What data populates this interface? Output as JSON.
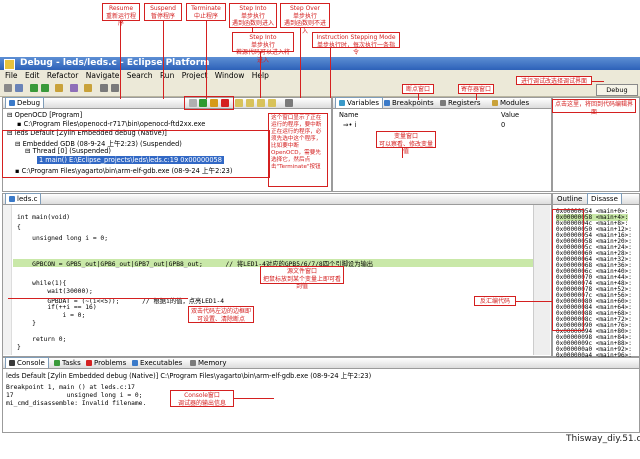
{
  "window": {
    "title": "Debug - leds/leds.c - Eclipse Platform"
  },
  "menu": [
    "File",
    "Edit",
    "Refactor",
    "Navigate",
    "Search",
    "Run",
    "Project",
    "Window",
    "Help"
  ],
  "perspective": {
    "label": "Debug"
  },
  "annotations": {
    "resume": "Resume\n重新运行程序",
    "suspend": "Suspend\n暂停程序",
    "terminate": "Terminate\n中止程序",
    "step_into_1": "Step Into\n单步执行\n遇到函数则进入",
    "step_into_2": "Step Into\n单步执行\n若源代码可以进入将进入",
    "step_over": "Step Over\n单步执行\n遇到函数则不进入",
    "instruction_stepping": "Instruction Stepping Mode\n单步执行时，每次执行一条指令",
    "breakpoint_window": "断点窗口",
    "register_window": "寄存器窗口",
    "perspective_switch": "进行调试改选择调试界面",
    "return_hint": "点击这里，将回到代码编辑界面",
    "debug_window_note": "这个窗口显示了正在运行的程序，要中断正在运行的程序，必须先选中这个程序，比如要中断OpenOCD，需要先选择它，然后点击\"Terminate\"按钮",
    "variable_window": "变量窗口\n可以察看、修改变量值",
    "source_window": "源文件窗口\n把鼠标放到某个变量上即可看到值",
    "disassembly_window": "反汇编代码",
    "breakpoint_hint": "双击代码左边的边框即可设置、清除断点",
    "console_window": "Console窗口\n调试器的输出信息"
  },
  "debug_view": {
    "tab": "Debug",
    "tree": [
      "OpenOCD [Program]",
      "C:\\Program Files\\openocd-r717\\bin\\openocd-ftd2xx.exe",
      "leds Default [Zylin Embedded debug (Native)]",
      "Embedded GDB (08-9-24 上午2:23) (Suspended)",
      "Thread [0] (Suspended)",
      "1 main() E:\\Eclipse_projects\\leds\\leds.c:19 0x00000058",
      "C:\\Program Files\\yagarto\\bin\\arm-elf-gdb.exe (08-9-24 上午2:23)"
    ]
  },
  "variables_view": {
    "tabs": [
      "Variables",
      "Breakpoints",
      "Registers",
      "Modules"
    ],
    "columns": [
      "Name",
      "Value"
    ],
    "rows": [
      {
        "name": "i",
        "value": "0"
      }
    ]
  },
  "editor": {
    "tab": "leds.c",
    "lines": [
      "int main(void)",
      "{",
      "    unsigned long i = 0;",
      "",
      "    GPBCON = GPB5_out|GPB6_out|GPB7_out|GPB8_out;      // 将LED1-4对应的GPB5/6/7/8四个引脚设为输出",
      "",
      "    while(1){",
      "        wait(30000);",
      "        GPBDAT = (~(i<<5));      // 根据i的值，点亮LED1-4",
      "        if(++i == 16)",
      "            i = 0;",
      "    }",
      "",
      "    return 0;",
      "}"
    ]
  },
  "disassembly_view": {
    "tabs": [
      "Outline",
      "Disasse"
    ],
    "rows": [
      "0x00000054 <main+0>:",
      "0x00000058 <main+4>:",
      "0x0000004c <main+8>:",
      "0x00000050 <main+12>:",
      "0x00000054 <main+16>:",
      "0x00000058 <main+20>:",
      "0x0000005c <main+24>:",
      "0x00000060 <main+28>:",
      "0x00000064 <main+32>:",
      "0x00000068 <main+36>:",
      "0x0000006c <main+40>:",
      "0x00000070 <main+44>:",
      "0x00000074 <main+48>:",
      "0x00000078 <main+52>:",
      "0x0000007c <main+56>:",
      "0x00000080 <main+60>:",
      "0x00000084 <main+64>:",
      "0x00000088 <main+68>:",
      "0x0000008c <main+72>:",
      "0x00000090 <main+76>:",
      "0x00000094 <main+80>:",
      "0x00000098 <main+84>:",
      "0x0000009c <main+88>:",
      "0x000000a0 <main+92>:",
      "0x000000a4 <main+96>:"
    ]
  },
  "console_view": {
    "tabs": [
      "Console",
      "Tasks",
      "Problems",
      "Executables",
      "Memory"
    ],
    "session": "leds Default [Zylin Embedded debug (Native)] C:\\Program Files\\yagarto\\bin\\arm-elf-gdb.exe (08-9-24 上午2:23)",
    "lines": [
      "Breakpoint 1, main () at leds.c:17",
      "17              unsigned long i = 0;",
      "mi_cmd_disassemble: Invalid filename."
    ]
  },
  "watermark": "Thisway_diy.51.c"
}
